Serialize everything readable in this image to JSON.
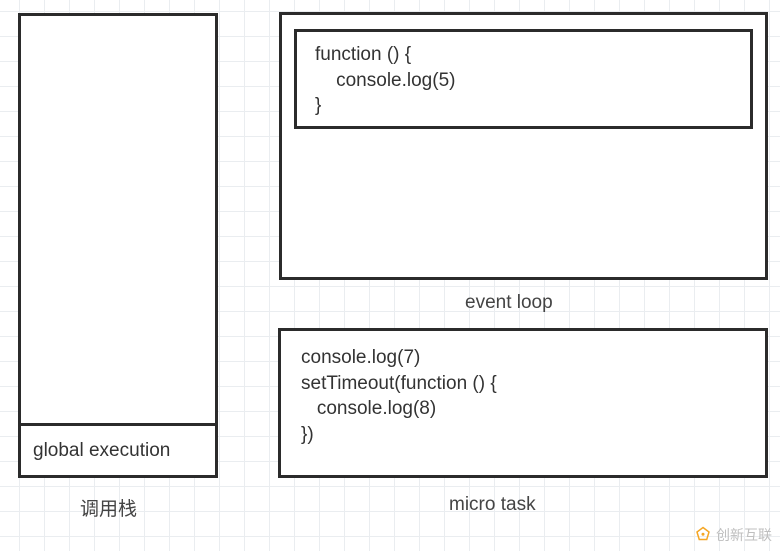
{
  "callstack": {
    "global_label": "global execution",
    "caption": "调用栈"
  },
  "event_loop": {
    "caption": "event loop",
    "task_code": "function () {\n    console.log(5)\n}"
  },
  "micro_task": {
    "caption": "micro task",
    "code": "console.log(7)\nsetTimeout(function () {\n   console.log(8)\n})"
  },
  "watermark": {
    "text": "创新互联"
  }
}
